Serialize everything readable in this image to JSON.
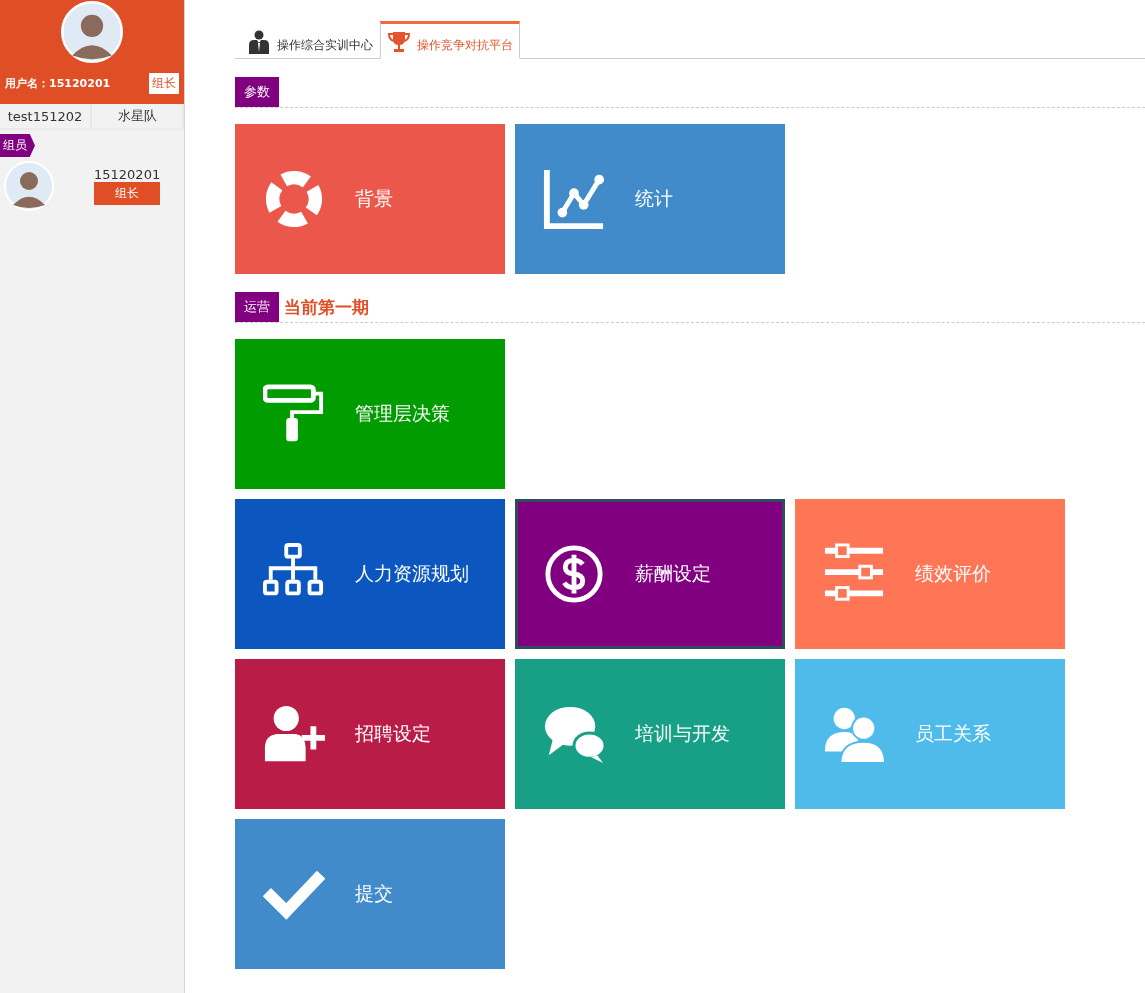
{
  "sidebar": {
    "username_label": "用户名：15120201",
    "role_badge": "组长",
    "account": "test151202",
    "team": "水星队",
    "members_tag": "组员",
    "members": [
      {
        "id_text": "15120201",
        "role": "组长"
      }
    ]
  },
  "tabs": [
    {
      "label": "操作综合实训中心",
      "kind": "person",
      "selected": false
    },
    {
      "label": "操作竞争对抗平台",
      "kind": "trophy",
      "selected": true
    }
  ],
  "sections": [
    {
      "tag": "参数",
      "rows": [
        [
          {
            "label": "背景",
            "kind": "lifebuoy",
            "color": "#ec574b",
            "selected": false
          },
          {
            "label": "统计",
            "kind": "chart",
            "color": "#428bca",
            "selected": false
          }
        ]
      ]
    },
    {
      "tag": "运营",
      "subtitle": "当前第一期",
      "rows": [
        [
          {
            "label": "管理层决策",
            "kind": "roller",
            "color": "#009c00",
            "selected": false
          }
        ],
        [
          {
            "label": "人力资源规划",
            "kind": "org",
            "color": "#0b57bf",
            "selected": false
          },
          {
            "label": "薪酬设定",
            "kind": "dollar",
            "color": "#800080",
            "selected": true
          },
          {
            "label": "绩效评价",
            "kind": "sliders",
            "color": "#ff7657",
            "selected": false
          }
        ],
        [
          {
            "label": "招聘设定",
            "kind": "userplus",
            "color": "#b91d47",
            "selected": false
          },
          {
            "label": "培训与开发",
            "kind": "chat",
            "color": "#17a086",
            "selected": false
          },
          {
            "label": "员工关系",
            "kind": "users",
            "color": "#4fbbeb",
            "selected": false
          }
        ],
        [
          {
            "label": "提交",
            "kind": "check",
            "color": "#428bca",
            "selected": false
          }
        ]
      ]
    }
  ]
}
